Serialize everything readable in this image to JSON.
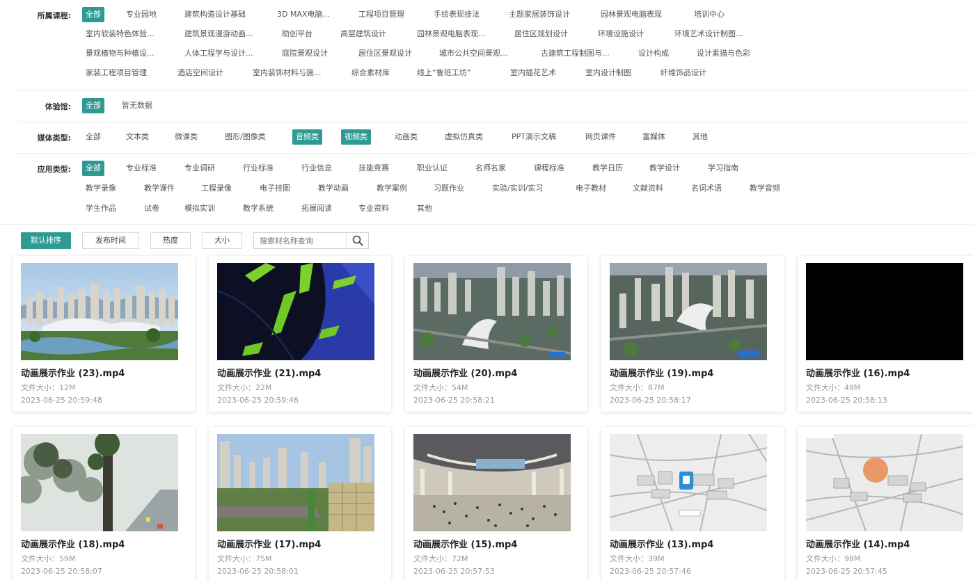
{
  "filters": {
    "course": {
      "label": "所属课程:",
      "rows": [
        [
          "全部",
          "专业园地",
          "建筑构造设计基础",
          "3D MAX电脑...",
          "工程项目管理",
          "手绘表现技法",
          "主题家居装饰设计",
          "园林景观电脑表现",
          "培训中心"
        ],
        [
          "室内软装特色体验...",
          "建筑景观漫游动画...",
          "助创平台",
          "高层建筑设计",
          "园林景观电脑表现...",
          "居住区规划设计",
          "环境设施设计",
          "环境艺术设计制图..."
        ],
        [
          "景观植物与种植设...",
          "人体工程学与设计...",
          "庭院景观设计",
          "居住区景观设计",
          "城市公共空间景观...",
          "古建筑工程制图与...",
          "设计构成",
          "设计素描与色彩"
        ],
        [
          "家装工程项目管理",
          "酒店空间设计",
          "室内装饰材料与施...",
          "综合素材库",
          "线上“鲁班工坊”",
          "室内插花艺术",
          "室内设计制图",
          "纤维饰品设计"
        ]
      ]
    },
    "experience": {
      "label": "体验馆:",
      "options": [
        "全部",
        "暂无数据"
      ]
    },
    "media": {
      "label": "媒体类型:",
      "options": [
        "全部",
        "文本类",
        "微课类",
        "图形/图像类",
        "音频类",
        "视频类",
        "动画类",
        "虚拟仿真类",
        "PPT演示文稿",
        "网页课件",
        "富媒体",
        "其他"
      ]
    },
    "application": {
      "label": "应用类型:",
      "rows": [
        [
          "全部",
          "专业标准",
          "专业调研",
          "行业标准",
          "行业信息",
          "技能竞赛",
          "职业认证",
          "名师名家",
          "课程标准",
          "教学日历",
          "教学设计",
          "学习指南"
        ],
        [
          "教学录像",
          "教学课件",
          "工程录像",
          "电子挂图",
          "教学动画",
          "教学案例",
          "习题作业",
          "实验/实训/实习",
          "电子教材",
          "文献资料",
          "名词术语",
          "教学音频"
        ],
        [
          "学生作品",
          "试卷",
          "模拟实训",
          "教学系统",
          "拓展阅读",
          "专业资料",
          "其他"
        ]
      ]
    }
  },
  "sort": {
    "buttons": [
      "默认排序",
      "发布时间",
      "热度",
      "大小"
    ],
    "search_placeholder": "搜索材名称查询"
  },
  "cards": [
    {
      "title": "动画展示作业 (23).mp4",
      "size": "文件大小：12M",
      "date": "2023-06-25 20:59:48"
    },
    {
      "title": "动画展示作业 (21).mp4",
      "size": "文件大小：22M",
      "date": "2023-06-25 20:59:46"
    },
    {
      "title": "动画展示作业 (20).mp4",
      "size": "文件大小：54M",
      "date": "2023-06-25 20:58:21"
    },
    {
      "title": "动画展示作业 (19).mp4",
      "size": "文件大小：87M",
      "date": "2023-06-25 20:58:17"
    },
    {
      "title": "动画展示作业 (16).mp4",
      "size": "文件大小：49M",
      "date": "2023-06-25 20:58:13"
    },
    {
      "title": "动画展示作业 (18).mp4",
      "size": "文件大小：59M",
      "date": "2023-06-25 20:58:07"
    },
    {
      "title": "动画展示作业 (17).mp4",
      "size": "文件大小：75M",
      "date": "2023-06-25 20:58:01"
    },
    {
      "title": "动画展示作业 (15).mp4",
      "size": "文件大小：72M",
      "date": "2023-06-25 20:57:53"
    },
    {
      "title": "动画展示作业 (13).mp4",
      "size": "文件大小：39M",
      "date": "2023-06-25 20:57:46"
    },
    {
      "title": "动画展示作业 (14).mp4",
      "size": "文件大小：98M",
      "date": "2023-06-25 20:57:45"
    }
  ],
  "colors": {
    "accent": "#2e9a93"
  }
}
